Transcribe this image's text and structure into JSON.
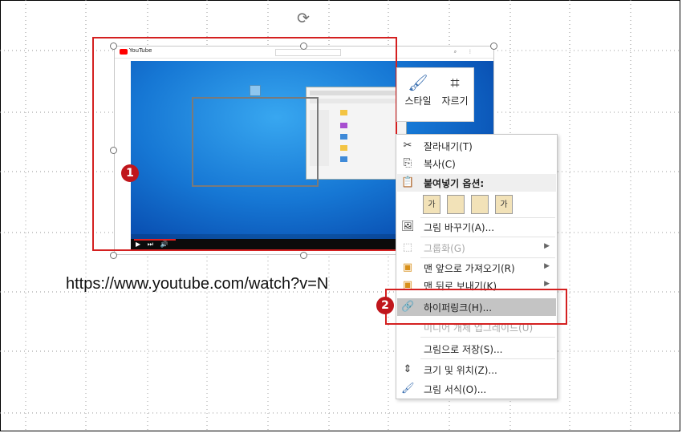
{
  "slide": {
    "url_text": "https://www.youtube.com/watch?v=N"
  },
  "video_thumbnail": {
    "site_name": "YouTube"
  },
  "mini_toolbar": {
    "style_label": "스타일",
    "crop_label": "자르기"
  },
  "callouts": {
    "first": "1",
    "second": "2"
  },
  "context_menu": {
    "items": [
      {
        "label": "잘라내기(T)",
        "icon": "scissors-icon",
        "enabled": true
      },
      {
        "label": "복사(C)",
        "icon": "copy-icon",
        "enabled": true
      },
      {
        "label": "붙여넣기 옵션:",
        "icon": "paste-icon",
        "enabled": true,
        "header": true
      },
      {
        "label": "그림 바꾸기(A)...",
        "icon": "change-picture-icon",
        "enabled": true
      },
      {
        "label": "그룹화(G)",
        "icon": "group-icon",
        "enabled": false,
        "submenu": true
      },
      {
        "label": "맨 앞으로 가져오기(R)",
        "icon": "bring-front-icon",
        "enabled": true,
        "submenu": true
      },
      {
        "label": "맨 뒤로 보내기(K)",
        "icon": "send-back-icon",
        "enabled": true,
        "submenu": true
      },
      {
        "label": "하이퍼링크(H)...",
        "icon": "hyperlink-icon",
        "enabled": true,
        "highlighted": true
      },
      {
        "label": "미디어 개체 업그레이드(U)",
        "icon": "",
        "enabled": false
      },
      {
        "label": "그림으로 저장(S)...",
        "icon": "",
        "enabled": true
      },
      {
        "label": "크기 및 위치(Z)...",
        "icon": "size-position-icon",
        "enabled": true
      },
      {
        "label": "그림 서식(O)...",
        "icon": "format-picture-icon",
        "enabled": true
      }
    ],
    "paste_options": [
      "가",
      "",
      "",
      "가"
    ]
  },
  "colors": {
    "accent_red": "#d42020",
    "callout_red": "#c0161c",
    "highlight": "#c4c4c4"
  }
}
